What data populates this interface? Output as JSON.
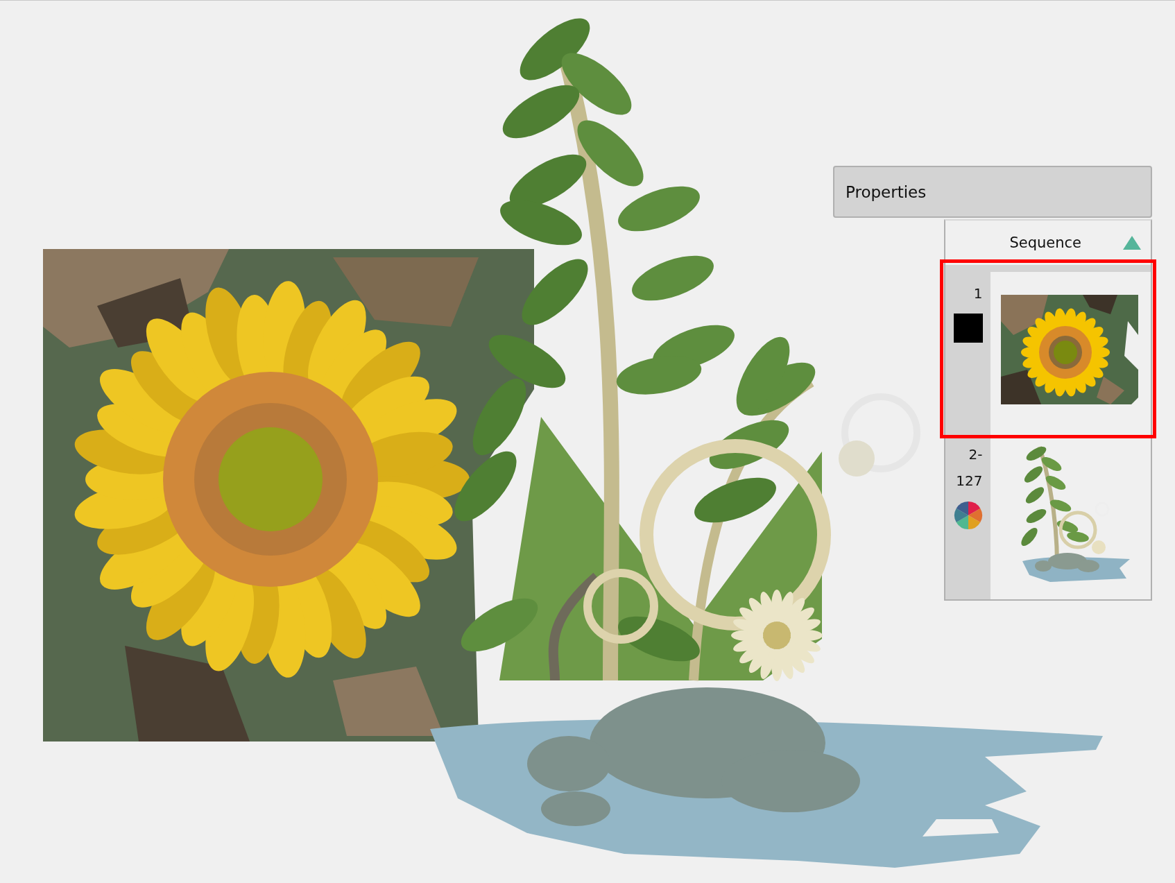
{
  "properties_panel": {
    "title": "Properties"
  },
  "sequence": {
    "title": "Sequence",
    "expanded": true,
    "items": [
      {
        "range": "1",
        "selected": true,
        "kind": "single_color",
        "color": "#000000"
      },
      {
        "range": "2-127",
        "selected": false,
        "kind": "multi_color"
      }
    ]
  }
}
